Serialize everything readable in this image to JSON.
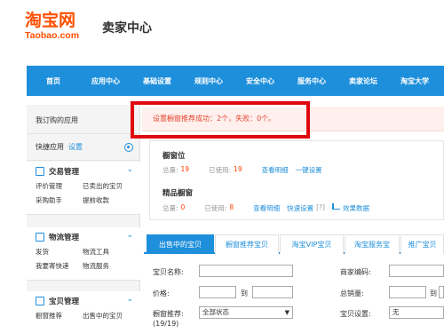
{
  "header": {
    "logo_cn": "淘宝网",
    "logo_en": "Taobao.com",
    "title": "卖家中心"
  },
  "nav": {
    "items": [
      "首页",
      "应用中心",
      "基础设置",
      "规则中心",
      "安全中心",
      "服务中心",
      "卖家论坛",
      "淘宝大学"
    ]
  },
  "sidebar": {
    "my_apps": "我订购的应用",
    "quick_apps": "快捷应用",
    "settings_link": "设置",
    "sections": [
      {
        "title": "交易管理",
        "items": [
          "评价管理",
          "已卖出的宝贝",
          "采购助手",
          "提前收款"
        ]
      },
      {
        "title": "物流管理",
        "items": [
          "发货",
          "物流工具",
          "我要寄快递",
          "物流服务"
        ]
      },
      {
        "title": "宝贝管理",
        "items": [
          "橱窗推荐",
          "出售中的宝贝"
        ]
      }
    ]
  },
  "alert": {
    "message": "设置橱窗推荐成功：2个，失败：0个。"
  },
  "showcase": {
    "title": "橱窗位",
    "total_label": "总量:",
    "total_value": "19",
    "used_label": "已使用:",
    "used_value": "19",
    "view_link": "查看明细",
    "setting_link": "一键设置"
  },
  "premium_showcase": {
    "title": "精品橱窗",
    "total_label": "总量:",
    "total_value": "0",
    "used_label": "已使用:",
    "used_value": "8",
    "view_link": "查看明细",
    "quick_link": "快速设置",
    "help": "[?]",
    "data_link": "效果数据"
  },
  "tabs": [
    "出售中的宝贝",
    "橱窗推荐宝贝",
    "淘宝VIP宝贝",
    "淘宝服务宝",
    "推广宝贝"
  ],
  "form": {
    "name_label": "宝贝名称:",
    "code_label": "商家编码:",
    "price_label": "价格:",
    "to_label": "到",
    "sales_label": "总销量:",
    "to_label2": "到",
    "recommend_label": "橱窗推荐:",
    "recommend_count": "(19/19)",
    "recommend_value": "全部状态",
    "item_setting_label": "宝贝设置:",
    "item_setting_value": "无"
  },
  "colors": {
    "brand": "#ff5000",
    "nav": "#1e8fdb",
    "highlight_box": "#e0070f",
    "alert_text": "#e4442b"
  }
}
